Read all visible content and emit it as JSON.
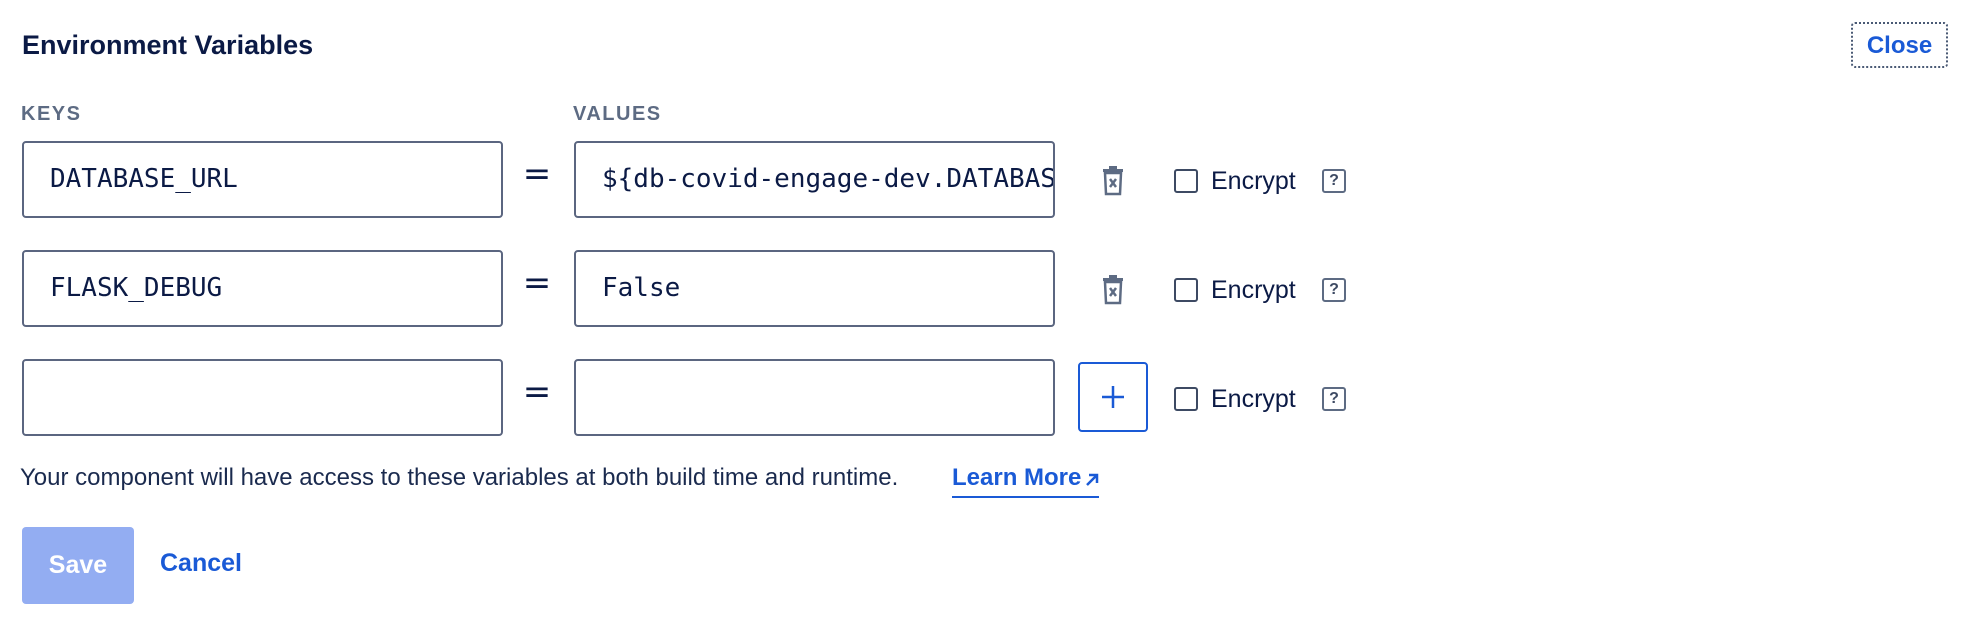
{
  "header": {
    "title": "Environment Variables",
    "close_label": "Close"
  },
  "columns": {
    "keys": "KEYS",
    "values": "VALUES"
  },
  "rows": [
    {
      "key": "DATABASE_URL",
      "value": "${db-covid-engage-dev.DATABASE_URL}",
      "encrypt_label": "Encrypt",
      "help": "?"
    },
    {
      "key": "FLASK_DEBUG",
      "value": "False",
      "encrypt_label": "Encrypt",
      "help": "?"
    },
    {
      "key": "",
      "value": "",
      "encrypt_label": "Encrypt",
      "help": "?"
    }
  ],
  "equals_sign": "=",
  "footer": {
    "note": "Your component will have access to these variables at both build time and runtime.",
    "learn_more": "Learn More",
    "save_label": "Save",
    "cancel_label": "Cancel"
  },
  "colors": {
    "accent": "#1a5ad6",
    "save_disabled": "#93adf2",
    "text": "#0b1a45"
  },
  "icons": {
    "delete": "trash-icon",
    "add": "plus-icon",
    "external": "arrow-up-right-icon"
  }
}
